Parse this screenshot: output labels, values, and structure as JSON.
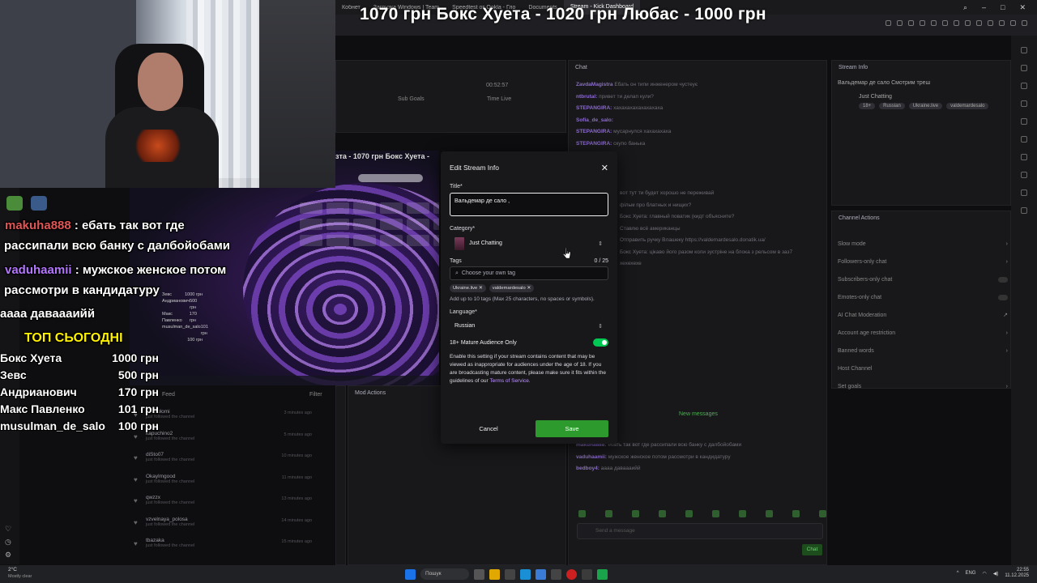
{
  "browser": {
    "tabs": [
      "Кобнет",
      "Загрузка Windows | Team",
      "Speedtest от Ookla - Гло",
      "Documents",
      "Stream - Kick Dashboard"
    ],
    "active_tab_index": 4
  },
  "ticker": {
    "text": "1070 грн   Бокс Хуета  -  1020 грн   Любас  -  1000 грн"
  },
  "capture": {
    "ticker": "зта  -  1070 грн   Бокс Хуета  -",
    "mini_top": [
      {
        "name": "Зевс",
        "amount": "1000 грн"
      },
      {
        "name": "Андрианович",
        "amount": "500 грн"
      },
      {
        "name": "Макс Павленко",
        "amount": "170 грн"
      },
      {
        "name": "musulman_de_salo",
        "amount": "101 грн"
      },
      {
        "name": "",
        "amount": "100 грн"
      }
    ]
  },
  "overlay": {
    "messages": [
      {
        "user": "makuha888",
        "text": " : ебать так вот где",
        "cont": "рассипали всю банку с далбойобами"
      },
      {
        "user": "vaduhaamii",
        "text": " : мужское женское потом",
        "cont": "рассмотри в кандидатуру"
      },
      {
        "user": "",
        "text": "аааа даваааийй",
        "cont": ""
      }
    ],
    "top_title": "ТОП СЬОГОДНІ",
    "top_list": [
      {
        "name": "Бокс Хуета",
        "amount": "1000 грн"
      },
      {
        "name": "Зевс",
        "amount": "500 грн"
      },
      {
        "name": "Андрианович",
        "amount": "170 грн"
      },
      {
        "name": "Макс Павленко",
        "amount": "101 грн"
      },
      {
        "name": "musulman_de_salo",
        "amount": "100 грн"
      }
    ]
  },
  "dashboard": {
    "stats": {
      "session_value": "00:52:57",
      "sub_label": "Sub Goals",
      "time_label": "Time Live"
    },
    "chat_title": "Chat",
    "stream_info_title": "Stream Info",
    "stream_info": {
      "title": "Вальдемар де сало Смотрим треш",
      "category": "Just Chatting",
      "tags": [
        "18+",
        "Russian",
        "Ukraine.live",
        "valdemardesalo"
      ]
    },
    "channel_actions_title": "Channel Actions",
    "channel_actions": [
      "Slow mode",
      "Followers-only chat",
      "Subscribers-only chat",
      "Emotes-only chat",
      "AI Chat Moderation",
      "Account age restriction",
      "Banned words",
      "Host Channel",
      "Set goals"
    ],
    "activity_title": "Feed",
    "activity_filter": "Filter",
    "mod_actions_title": "Mod Actions",
    "feed": [
      {
        "name": "puhsolomi",
        "sub": "just followed the channel",
        "time": "3 minutes ago"
      },
      {
        "name": "kapuchino2",
        "sub": "just followed the channel",
        "time": "5 minutes ago"
      },
      {
        "name": "diSto07",
        "sub": "just followed the channel",
        "time": "10 minutes ago"
      },
      {
        "name": "Okaylmgood",
        "sub": "just followed the channel",
        "time": "11 minutes ago"
      },
      {
        "name": "qwzzx",
        "sub": "just followed the channel",
        "time": "13 minutes ago"
      },
      {
        "name": "vzvelnaya_polosa",
        "sub": "just followed the channel",
        "time": "14 minutes ago"
      },
      {
        "name": "tbazaka",
        "sub": "just followed the channel",
        "time": "15 minutes ago"
      }
    ],
    "chat_messages": [
      {
        "user": "ZavdaMagistra",
        "text": "Ебать он типи инженером чустеує"
      },
      {
        "user": "ntbrutal:",
        "text": "привет ти делап кули?"
      },
      {
        "user": "STEPANGIRA:",
        "text": "хахахахахахахахаха"
      },
      {
        "user": "",
        "text": ""
      },
      {
        "user": "Sofia_de_salo:",
        "text": ""
      },
      {
        "user": "STEPANGIRA:",
        "text": "мусарнулся хахахахаха"
      },
      {
        "user": "STEPANGIRA:",
        "text": "скупо банька"
      }
    ],
    "chat_more": [
      {
        "user": "",
        "text": "вот тут ти будет хорошо не переживай"
      },
      {
        "user": "",
        "text": "фільм про блатных и нищих?"
      },
      {
        "user": "",
        "text": "Бокс Хуета: главный поватик (кидт объясните?"
      },
      {
        "user": "",
        "text": "Ставлю всё американцы"
      },
      {
        "user": "",
        "text": "Отправить ручку Влашеку https://valdemardesalo.donatik.ua/"
      },
      {
        "user": "",
        "text": "Бокс Хуета: цікаво його разом коли зустріне на блока з рельсом в заз7"
      },
      {
        "user": "",
        "text": "хехехехе"
      }
    ],
    "new_messages": "New messages",
    "chat_bottom": [
      {
        "user": "makuha888:",
        "text": "ебать так вот где рассипали всю банку с далбойобами"
      },
      {
        "user": "vaduhaamii:",
        "text": "мужское женское потом рассмотри в кандидатуру"
      },
      {
        "user": "bedboy4:",
        "text": "аааа даваааийй"
      }
    ],
    "chat_placeholder": "Send a message",
    "chat_send": "Chat"
  },
  "modal": {
    "title": "Edit Stream Info",
    "title_label": "Title*",
    "title_value": "Вальдемар де сало ,",
    "category_label": "Category*",
    "category_value": "Just Chatting",
    "tags_label": "Tags",
    "tags_count": "0 / 25",
    "tags_placeholder": "Choose your own tag",
    "tags": [
      "Ukraine.live",
      "valdemardesalo"
    ],
    "tags_help": "Add up to 10 tags (Max 25 characters, no spaces or symbols).",
    "language_label": "Language*",
    "language_value": "Russian",
    "mature_label": "18+ Mature Audience Only",
    "mature_on": true,
    "mature_desc": "Enable this setting if your stream contains content that may be viewed as inappropriate for audiences under the age of 18. If you are broadcasting mature content, please make sure it fits within the guidelines of our",
    "tos_link": "Terms of Service.",
    "cancel": "Cancel",
    "save": "Save"
  },
  "taskbar": {
    "weather_temp": "2°C",
    "weather_desc": "Mostly clear",
    "search": "Пошук",
    "lang": "ENG",
    "time": "22:55",
    "date": "11.12.2025"
  },
  "colors": {
    "accent": "#53fc18",
    "save_button": "#2c9a2c",
    "toggle_on": "#00c853",
    "overlay_user1": "#e05555",
    "overlay_user2": "#b476ff",
    "top_title": "#fff200"
  }
}
